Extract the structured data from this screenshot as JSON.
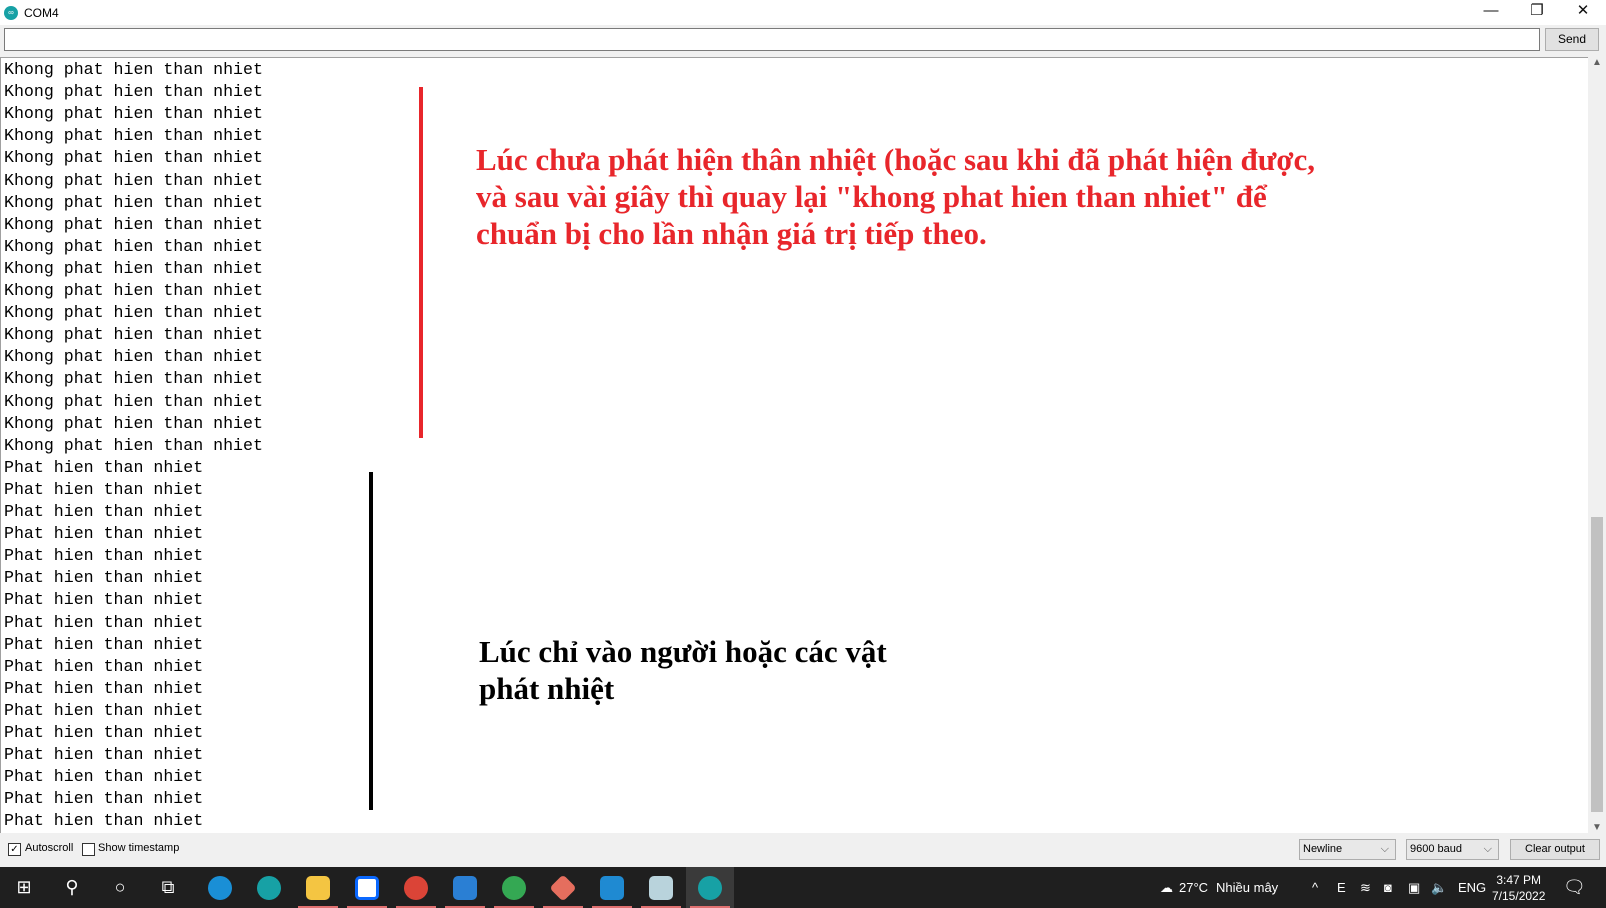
{
  "window": {
    "title": "COM4",
    "minimize": "—",
    "maximize": "❐",
    "close": "✕"
  },
  "send": {
    "input_value": "",
    "button": "Send"
  },
  "output": {
    "lines": [
      "Khong phat hien than nhiet",
      "Khong phat hien than nhiet",
      "Khong phat hien than nhiet",
      "Khong phat hien than nhiet",
      "Khong phat hien than nhiet",
      "Khong phat hien than nhiet",
      "Khong phat hien than nhiet",
      "Khong phat hien than nhiet",
      "Khong phat hien than nhiet",
      "Khong phat hien than nhiet",
      "Khong phat hien than nhiet",
      "Khong phat hien than nhiet",
      "Khong phat hien than nhiet",
      "Khong phat hien than nhiet",
      "Khong phat hien than nhiet",
      "Khong phat hien than nhiet",
      "Khong phat hien than nhiet",
      "Khong phat hien than nhiet",
      "Phat hien than nhiet",
      "Phat hien than nhiet",
      "Phat hien than nhiet",
      "Phat hien than nhiet",
      "Phat hien than nhiet",
      "Phat hien than nhiet",
      "Phat hien than nhiet",
      "Phat hien than nhiet",
      "Phat hien than nhiet",
      "Phat hien than nhiet",
      "Phat hien than nhiet",
      "Phat hien than nhiet",
      "Phat hien than nhiet",
      "Phat hien than nhiet",
      "Phat hien than nhiet",
      "Phat hien than nhiet",
      "Phat hien than nhiet"
    ]
  },
  "annotations": {
    "red": "Lúc chưa phát hiện thân nhiệt (hoặc sau khi đã phát hiện được, và sau vài giây thì quay lại \"khong phat hien than nhiet\" để chuẩn bị cho lần nhận giá trị tiếp theo.",
    "black": "Lúc chỉ vào người hoặc các vật phát nhiệt",
    "red_color": "#e8262b"
  },
  "bottom": {
    "autoscroll": "Autoscroll",
    "autoscroll_checked": true,
    "timestamp": "Show timestamp",
    "timestamp_checked": false,
    "line_ending": "Newline",
    "baud": "9600 baud",
    "clear": "Clear output"
  },
  "taskbar": {
    "icons": [
      "windows-start",
      "search",
      "cortana",
      "task-view",
      "edge",
      "arduino",
      "file-explorer",
      "zalo",
      "chrome-profile",
      "photos",
      "chrome",
      "git",
      "vscode",
      "notepad",
      "arduino-active"
    ],
    "weather": "27°C",
    "weather_desc": "Nhiều mây",
    "lang": "ENG",
    "time": "3:47 PM",
    "date": "7/15/2022"
  }
}
